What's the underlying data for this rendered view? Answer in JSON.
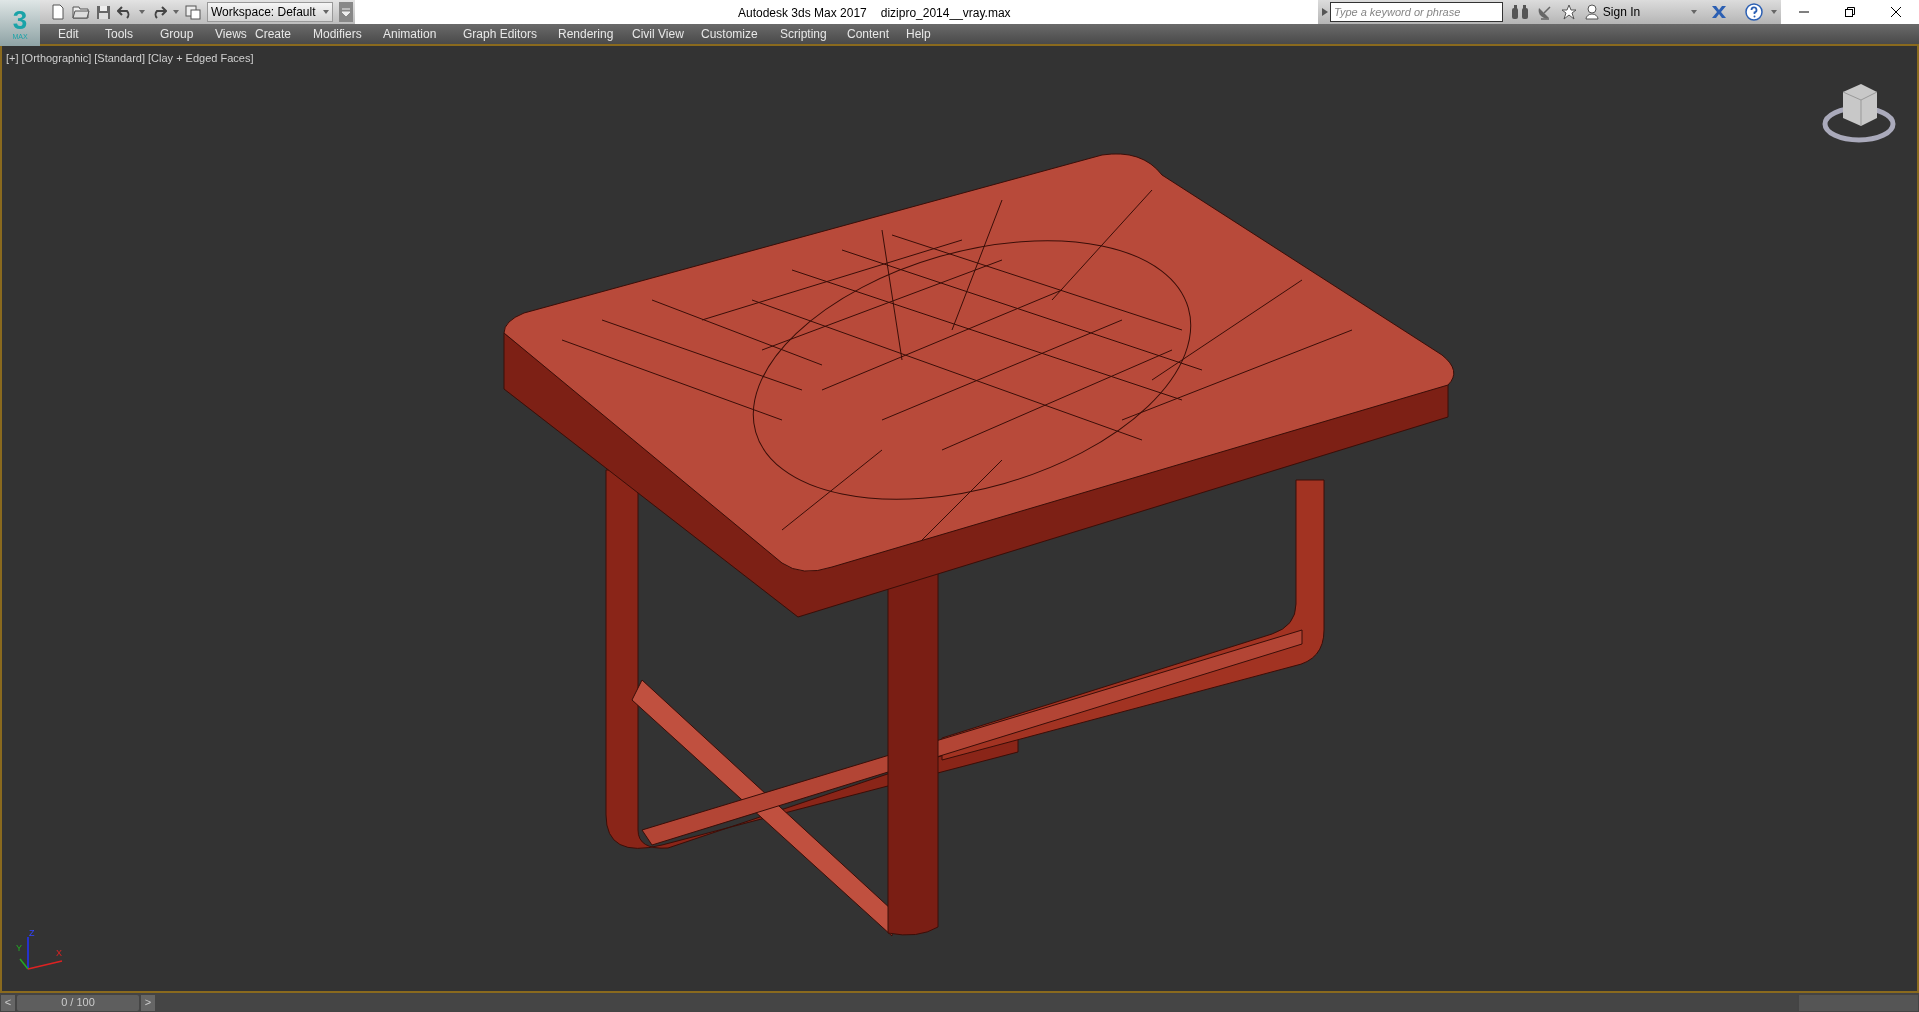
{
  "logo": {
    "digit": "3",
    "caption": "MAX"
  },
  "title_bar": {
    "workspace": "Workspace: Default",
    "app_title": "Autodesk 3ds Max 2017",
    "file_name": "dizipro_2014__vray.max",
    "search": {
      "placeholder": "Type a keyword or phrase"
    },
    "sign_in": "Sign In"
  },
  "menu": [
    "Edit",
    "Tools",
    "Group",
    "Views",
    "Create",
    "Modifiers",
    "Animation",
    "Graph Editors",
    "Rendering",
    "Civil View",
    "Customize",
    "Scripting",
    "Content",
    "Help"
  ],
  "viewport": {
    "labels": [
      "[+]",
      "[Orthographic]",
      "[Standard]",
      "[Clay + Edged Faces]"
    ],
    "axes": [
      "Z",
      "Y",
      "X"
    ]
  },
  "time_slider": {
    "prev": "<",
    "reading": "0 / 100",
    "next": ">",
    "level": 0
  }
}
